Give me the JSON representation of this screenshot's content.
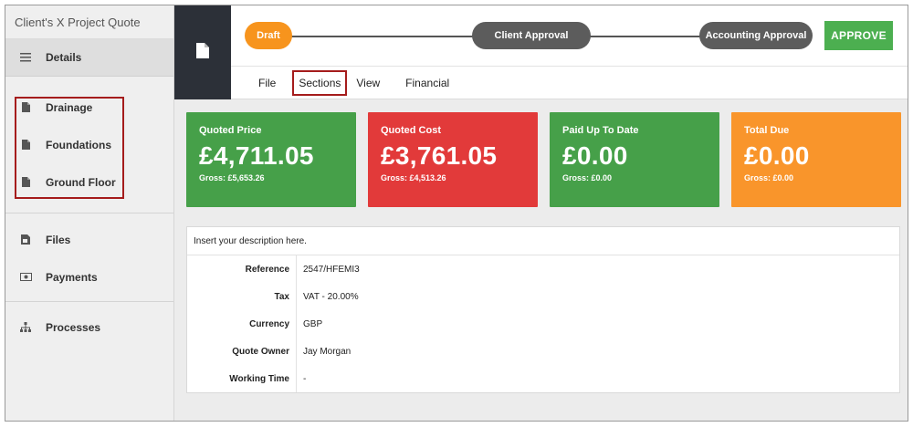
{
  "sidebar": {
    "title": "Client's X Project Quote",
    "details": {
      "label": "Details",
      "icon": "menu-icon"
    },
    "sections": [
      {
        "label": "Drainage",
        "icon": "document-icon"
      },
      {
        "label": "Foundations",
        "icon": "document-icon"
      },
      {
        "label": "Ground Floor",
        "icon": "document-icon"
      }
    ],
    "files": {
      "label": "Files",
      "icon": "file-image-icon"
    },
    "payments": {
      "label": "Payments",
      "icon": "payment-icon"
    },
    "processes": {
      "label": "Processes",
      "icon": "sitemap-icon"
    }
  },
  "workflow": {
    "steps": [
      "Draft",
      "Client Approval",
      "Accounting Approval"
    ],
    "approve_label": "APPROVE"
  },
  "menu": [
    "File",
    "Sections",
    "View",
    "Financial"
  ],
  "cards": [
    {
      "label": "Quoted Price",
      "amount": "£4,711.05",
      "gross": "Gross: £5,653.26",
      "color": "#46a049"
    },
    {
      "label": "Quoted Cost",
      "amount": "£3,761.05",
      "gross": "Gross: £4,513.26",
      "color": "#e23a3a"
    },
    {
      "label": "Paid Up To Date",
      "amount": "£0.00",
      "gross": "Gross: £0.00",
      "color": "#46a049"
    },
    {
      "label": "Total Due",
      "amount": "£0.00",
      "gross": "Gross: £0.00",
      "color": "#f9952b"
    }
  ],
  "details": {
    "description": "Insert your description here.",
    "rows": [
      {
        "key": "Reference",
        "value": "2547/HFEMI3"
      },
      {
        "key": "Tax",
        "value": "VAT - 20.00%"
      },
      {
        "key": "Currency",
        "value": "GBP"
      },
      {
        "key": "Quote Owner",
        "value": "Jay Morgan"
      },
      {
        "key": "Working Time",
        "value": "-"
      }
    ]
  }
}
